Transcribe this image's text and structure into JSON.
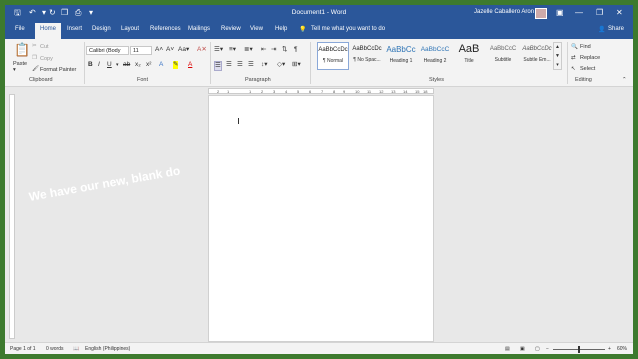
{
  "title_bar": {
    "title": "Document1 - Word",
    "user": "Jazelle Caballero Aron",
    "save_icon": "save-icon",
    "undo_icon": "undo-icon",
    "redo_icon": "redo-icon",
    "minimize_icon": "minimize-icon",
    "restore_icon": "restore-icon",
    "close_icon": "close-icon"
  },
  "menu_tabs": [
    "File",
    "Home",
    "Insert",
    "Design",
    "Layout",
    "References",
    "Mailings",
    "Review",
    "View",
    "Help"
  ],
  "active_tab": "Home",
  "tell_me": "Tell me what you want to do",
  "share": "Share",
  "ribbon": {
    "clipboard": {
      "label": "Clipboard",
      "paste": "Paste",
      "cut": "Cut",
      "copy": "Copy",
      "format_painter": "Format Painter"
    },
    "font": {
      "label": "Font",
      "font_name": "Calibri (Body",
      "font_size": "11"
    },
    "paragraph": {
      "label": "Paragraph"
    },
    "styles": {
      "label": "Styles",
      "items": [
        {
          "preview": "AaBbCcDc",
          "name": "¶ Normal"
        },
        {
          "preview": "AaBbCcDc",
          "name": "¶ No Spac..."
        },
        {
          "preview": "AaBbCc",
          "name": "Heading 1"
        },
        {
          "preview": "AaBbCcC",
          "name": "Heading 2"
        },
        {
          "preview": "AaB",
          "name": "Title"
        },
        {
          "preview": "AaBbCcC",
          "name": "Subtitle"
        },
        {
          "preview": "AaBbCcDc",
          "name": "Subtle Em..."
        }
      ]
    },
    "editing": {
      "label": "Editing",
      "find": "Find",
      "replace": "Replace",
      "select": "Select"
    }
  },
  "ruler": {
    "h_numbers": [
      "2",
      "1",
      "1",
      "2",
      "3",
      "4",
      "5",
      "6",
      "7",
      "8",
      "9",
      "10",
      "11",
      "12",
      "13",
      "14",
      "15",
      "16",
      "18"
    ]
  },
  "overlay_text": "We have our new, blank do",
  "status": {
    "page": "Page 1 of 1",
    "words": "0 words",
    "language": "English (Philippines)",
    "zoom": "60%"
  },
  "colors": {
    "word_blue": "#2b579a",
    "background_green": "#3d7a2e"
  }
}
